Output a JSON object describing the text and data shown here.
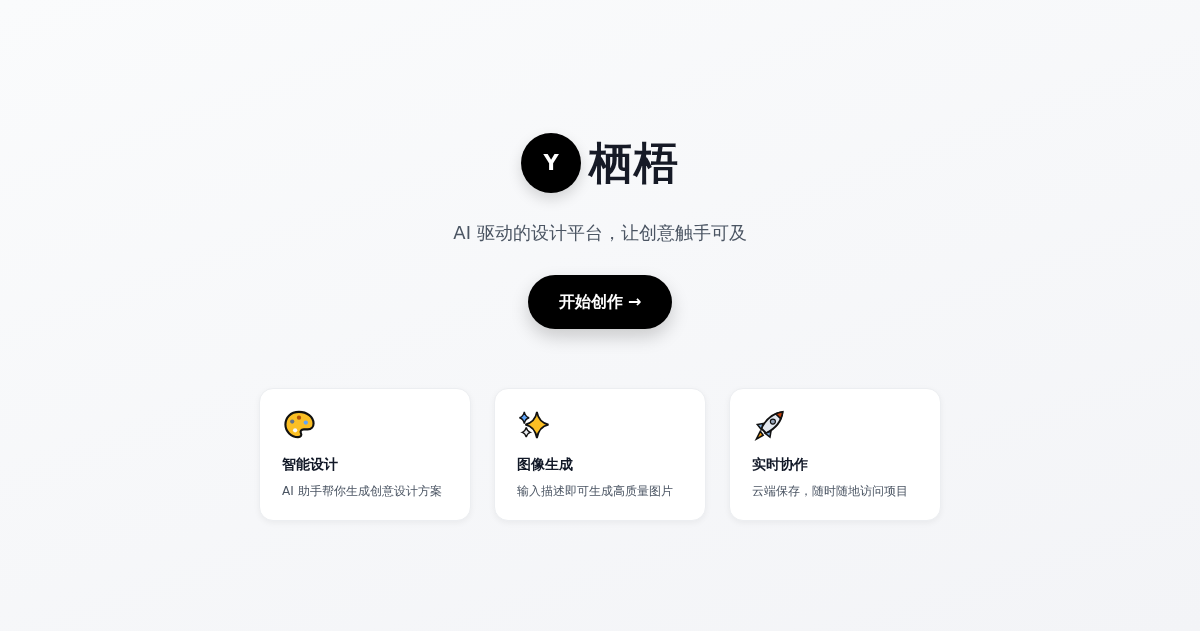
{
  "brand": {
    "logo_letter": "Y",
    "name": "栖梧"
  },
  "tagline": "AI 驱动的设计平台，让创意触手可及",
  "cta": {
    "label": "开始创作 →"
  },
  "features": [
    {
      "kind": "palette",
      "title": "智能设计",
      "description": "AI 助手帮你生成创意设计方案"
    },
    {
      "kind": "sparkles",
      "title": "图像生成",
      "description": "输入描述即可生成高质量图片"
    },
    {
      "kind": "rocket",
      "title": "实时协作",
      "description": "云端保存，随时随地访问项目"
    }
  ]
}
